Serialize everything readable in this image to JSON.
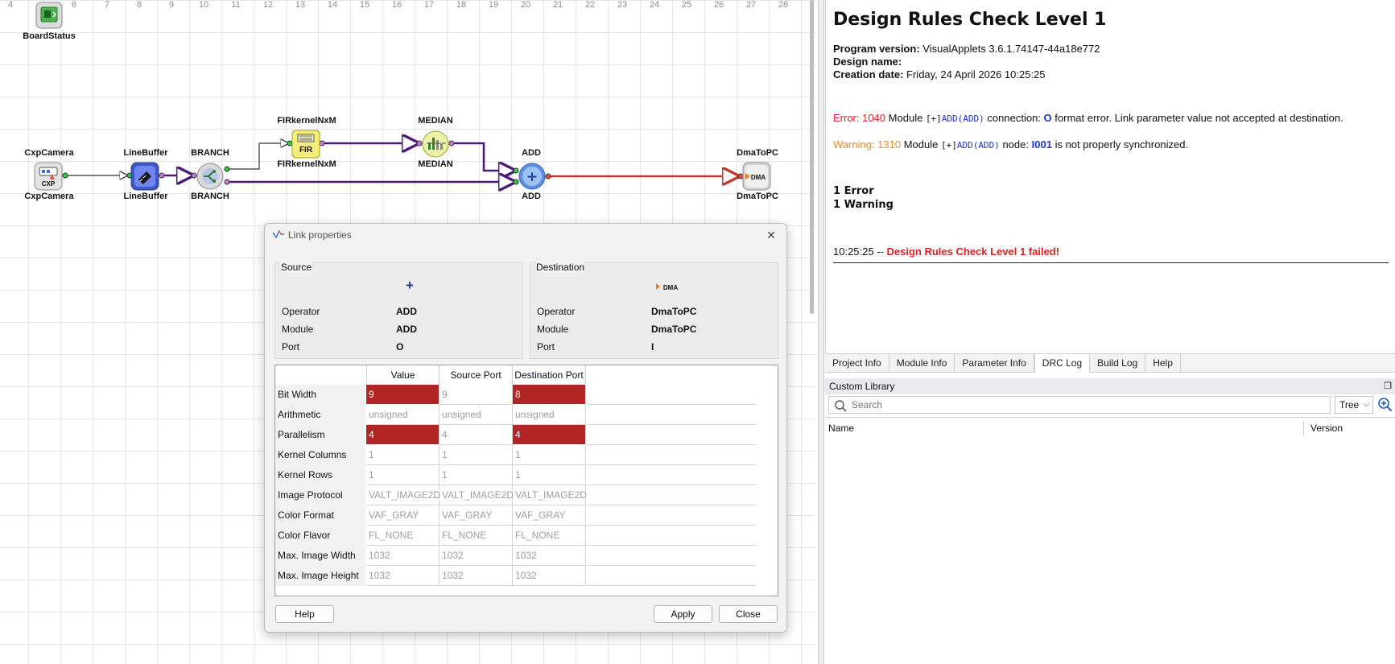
{
  "canvas": {
    "ruler": [
      "4",
      "6",
      "7",
      "8",
      "9",
      "10",
      "11",
      "12",
      "13",
      "14",
      "15",
      "16",
      "17",
      "18",
      "19",
      "20",
      "21",
      "22",
      "23",
      "24",
      "25",
      "26",
      "27",
      "28"
    ],
    "modules": {
      "boardstatus": {
        "label": "BoardStatus",
        "icon": "board-status-icon"
      },
      "cxpcamera": {
        "top_label": "CxpCamera",
        "bottom_label": "CxpCamera",
        "icon_text": "CXP",
        "icon": "camera-icon"
      },
      "linebuffer": {
        "top_label": "LineBuffer",
        "bottom_label": "LineBuffer",
        "icon": "line-buffer-icon"
      },
      "branch": {
        "top_label": "BRANCH",
        "bottom_label": "BRANCH",
        "icon": "branch-icon"
      },
      "fir": {
        "top_label": "FIRkernelNxM",
        "bottom_label": "FIRkernelNxM",
        "icon_text": "FIR",
        "icon": "fir-icon"
      },
      "median": {
        "top_label": "MEDIAN",
        "bottom_label": "MEDIAN",
        "icon": "median-icon"
      },
      "add": {
        "top_label": "ADD",
        "bottom_label": "ADD",
        "icon_text": "+",
        "icon": "add-icon"
      },
      "dmatopc": {
        "top_label": "DmaToPC",
        "bottom_label": "DmaToPC",
        "icon_text": "DMA",
        "icon": "dma-icon"
      }
    }
  },
  "log": {
    "title": "Design Rules Check Level 1",
    "program_version_label": "Program version:",
    "program_version": "VisualApplets 3.6.1.74147-44a18e772",
    "design_name_label": "Design name:",
    "creation_date_label": "Creation date:",
    "creation_date": "Friday, 24 April 2026 10:25:25",
    "error": {
      "prefix": "Error: 1040",
      "module_word": "Module",
      "module_tag": "[+]",
      "module_ref": "ADD(ADD)",
      "middle": "connection:",
      "port": "O",
      "message": "format error. Link parameter value not accepted at destination."
    },
    "warning": {
      "prefix": "Warning: 1310",
      "module_word": "Module",
      "module_tag": "[+]",
      "module_ref": "ADD(ADD)",
      "middle": "node:",
      "port": "I001",
      "message": "is not properly synchronized."
    },
    "summary_errors": "1 Error",
    "summary_warnings": "1 Warning",
    "time": "10:25:25 --",
    "failed": "Design Rules Check Level 1 failed!"
  },
  "tabs": [
    "Project Info",
    "Module Info",
    "Parameter Info",
    "DRC Log",
    "Build Log",
    "Help"
  ],
  "active_tab": "DRC Log",
  "library": {
    "title": "Custom Library",
    "search_placeholder": "Search",
    "view": "Tree",
    "col_name": "Name",
    "col_version": "Version"
  },
  "dialog": {
    "title": "Link properties",
    "source": {
      "group": "Source",
      "icon_text": "+",
      "operator_label": "Operator",
      "operator": "ADD",
      "module_label": "Module",
      "module": "ADD",
      "port_label": "Port",
      "port": "O"
    },
    "destination": {
      "group": "Destination",
      "icon_text": "DMA",
      "operator_label": "Operator",
      "operator": "DmaToPC",
      "module_label": "Module",
      "module": "DmaToPC",
      "port_label": "Port",
      "port": "I"
    },
    "columns": [
      "Value",
      "Source Port",
      "Destination Port"
    ],
    "rows": [
      {
        "label": "Bit Width",
        "value": "9",
        "source": "9",
        "dest": "8",
        "error": true
      },
      {
        "label": "Arithmetic",
        "value": "unsigned",
        "source": "unsigned",
        "dest": "unsigned",
        "error": false
      },
      {
        "label": "Parallelism",
        "value": "4",
        "source": "4",
        "dest": "4",
        "error": true
      },
      {
        "label": "Kernel Columns",
        "value": "1",
        "source": "1",
        "dest": "1",
        "error": false
      },
      {
        "label": "Kernel Rows",
        "value": "1",
        "source": "1",
        "dest": "1",
        "error": false
      },
      {
        "label": "Image Protocol",
        "value": "VALT_IMAGE2D",
        "source": "VALT_IMAGE2D",
        "dest": "VALT_IMAGE2D",
        "error": false
      },
      {
        "label": "Color Format",
        "value": "VAF_GRAY",
        "source": "VAF_GRAY",
        "dest": "VAF_GRAY",
        "error": false
      },
      {
        "label": "Color Flavor",
        "value": "FL_NONE",
        "source": "FL_NONE",
        "dest": "FL_NONE",
        "error": false
      },
      {
        "label": "Max. Image Width",
        "value": "1032",
        "source": "1032",
        "dest": "1032",
        "error": false
      },
      {
        "label": "Max. Image Height",
        "value": "1032",
        "source": "1032",
        "dest": "1032",
        "error": false
      }
    ],
    "help_button": "Help",
    "apply_button": "Apply",
    "close_button": "Close",
    "colors": {
      "error_cell": "#b22525"
    }
  },
  "colors": {
    "wire": "#4b1a7a",
    "error_wire": "#c0392b",
    "error_text": "#e02020",
    "warning_text": "#f08a24",
    "link_blue": "#1a33d6"
  }
}
